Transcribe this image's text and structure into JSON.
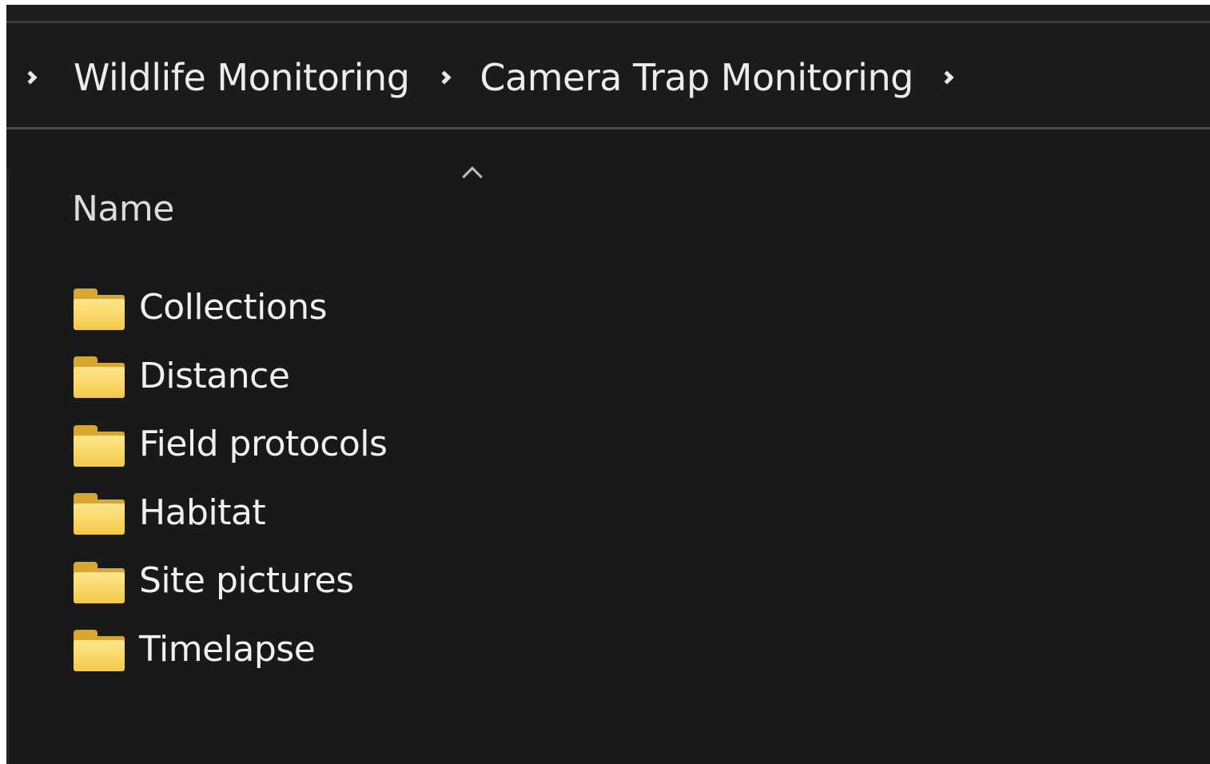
{
  "breadcrumb": {
    "items": [
      "Wildlife Monitoring",
      "Camera Trap Monitoring"
    ]
  },
  "file_list": {
    "column_header": "Name",
    "sort_direction": "ascending",
    "items": [
      {
        "name": "Collections",
        "type": "folder"
      },
      {
        "name": "Distance",
        "type": "folder"
      },
      {
        "name": "Field protocols",
        "type": "folder"
      },
      {
        "name": "Habitat",
        "type": "folder"
      },
      {
        "name": "Site pictures",
        "type": "folder"
      },
      {
        "name": "Timelapse",
        "type": "folder"
      }
    ]
  },
  "colors": {
    "background": "#1c1c1c",
    "text": "#f0f0f0",
    "folder": "#f3c947"
  }
}
